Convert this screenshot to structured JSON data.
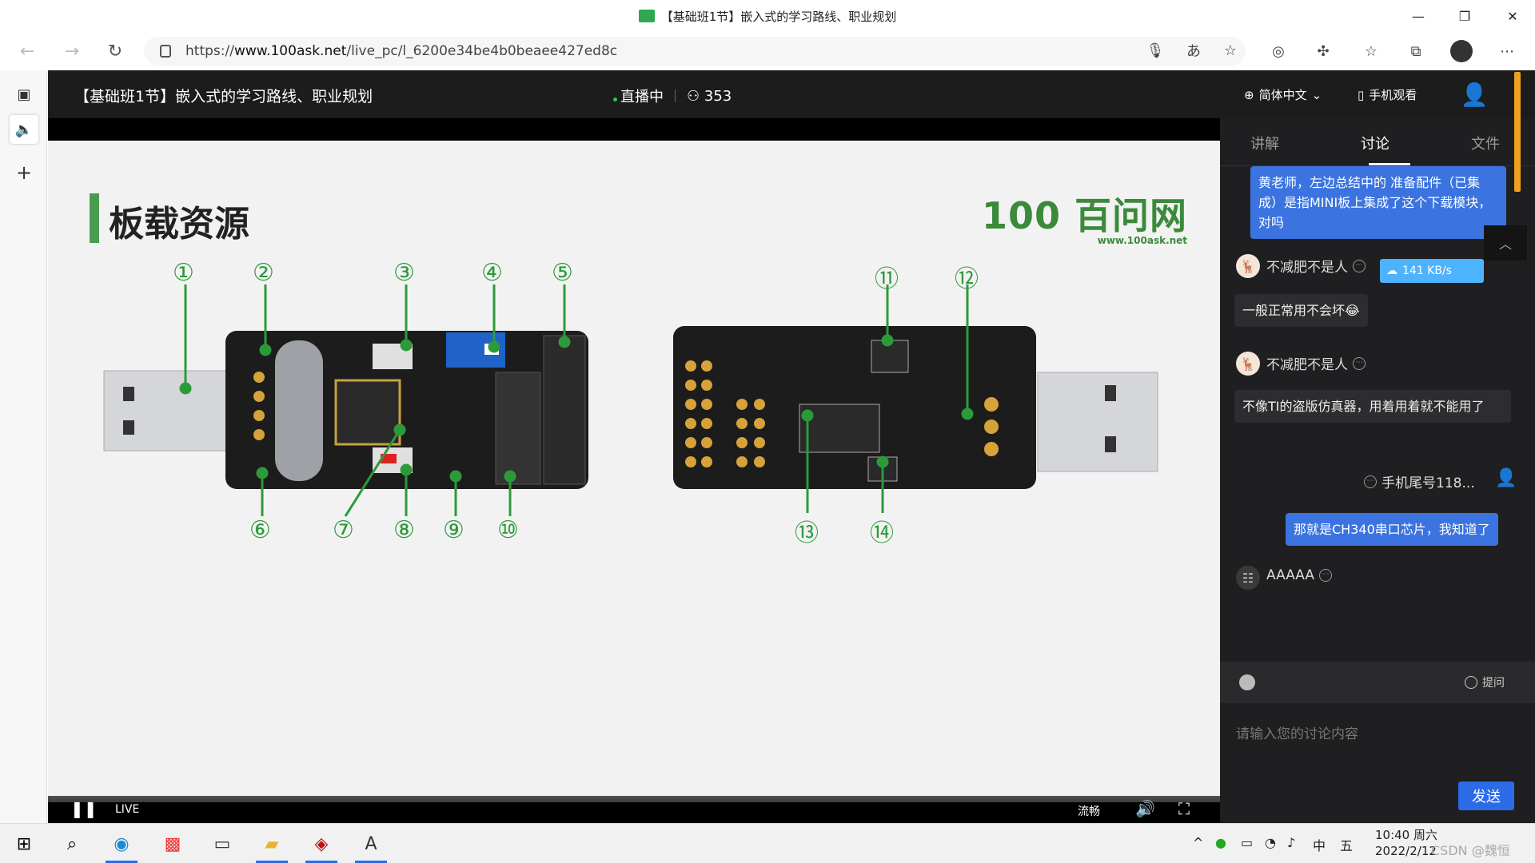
{
  "window": {
    "title": "【基础班1节】嵌入式的学习路线、职业规划"
  },
  "browser": {
    "url_prefix": "https://",
    "url_host": "www.100ask.net",
    "url_path": "/live_pc/l_6200e34be4b0beaee427ed8c"
  },
  "page": {
    "title": "【基础班1节】嵌入式的学习路线、职业规划",
    "status": "直播中",
    "viewers": "353",
    "language": "简体中文",
    "mobile_watch": "手机观看"
  },
  "slide": {
    "title": "板载资源",
    "logo_main": "100 百问网",
    "logo_url": "www.100ask.net",
    "callouts_left": [
      "①",
      "②",
      "③",
      "④",
      "⑤",
      "⑥",
      "⑦",
      "⑧",
      "⑨",
      "⑩"
    ],
    "callouts_right": [
      "⑪",
      "⑫",
      "⑬",
      "⑭"
    ]
  },
  "video": {
    "live_label": "LIVE",
    "quality": "流畅"
  },
  "side": {
    "tabs": [
      "讲解",
      "讨论",
      "文件"
    ],
    "active_tab": "讨论",
    "messages": [
      {
        "from": "me",
        "text": "黄老师，左边总结中的 准备配件（已集成）是指MINI板上集成了这个下载模块，对吗"
      },
      {
        "from": "other",
        "user": "不减肥不是人",
        "text": "一般正常用不会坏😂"
      },
      {
        "from": "other",
        "user": "不减肥不是人",
        "text": "不像TI的盗版仿真器，用着用着就不能用了"
      },
      {
        "from": "me",
        "user": "手机尾号118...",
        "text": "那就是CH340串口芯片，我知道了"
      },
      {
        "from": "other",
        "user": "AAAAA",
        "text": ""
      }
    ],
    "speed": "141 KB/s",
    "ask_label": "提问",
    "input_placeholder": "请输入您的讨论内容",
    "send_label": "发送"
  },
  "taskbar": {
    "ime": "中",
    "ime2": "五",
    "time": "10:40 周六",
    "date": "2022/2/12",
    "watermark": "CSDN @魏恒"
  }
}
